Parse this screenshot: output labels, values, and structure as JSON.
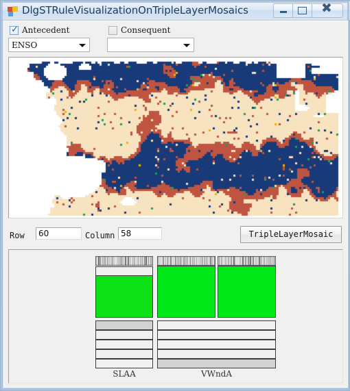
{
  "window": {
    "title": "DlgSTRuleVisualizationOnTripleLayerMosaics",
    "icon": "winforms-app-icon",
    "buttons": {
      "minimize": "minimize-icon",
      "maximize": "maximize-icon",
      "close": "close-icon"
    }
  },
  "controls": {
    "antecedent": {
      "label": "Antecedent",
      "checked": true,
      "combo_value": "ENSO"
    },
    "consequent": {
      "label": "Consequent",
      "checked": false,
      "combo_value": ""
    }
  },
  "map": {
    "name": "spatial-mosaic-map",
    "palette": {
      "blue": "#183a78",
      "red": "#bf5540",
      "cream": "#f7e3c0",
      "white": "#ffffff",
      "green": "#1aa05a",
      "yellow": "#f0b400"
    }
  },
  "coords": {
    "row_label": "Row",
    "row_value": "60",
    "column_label": "Column",
    "column_value": "58"
  },
  "actions": {
    "triple_layer_mosaic": "TripleLayerMosaic"
  },
  "mosaic": {
    "columns": [
      {
        "name": "SLAA",
        "label": "SLAA"
      },
      {
        "name": "VWndA",
        "label": "VWndA"
      }
    ]
  },
  "colors": {
    "green_primary": "#0ce215",
    "green_secondary": "#00e818",
    "panel_bg": "#f0f0f0",
    "gray_row": "#d2d2d2",
    "accent_title": "#1d3c5c"
  }
}
